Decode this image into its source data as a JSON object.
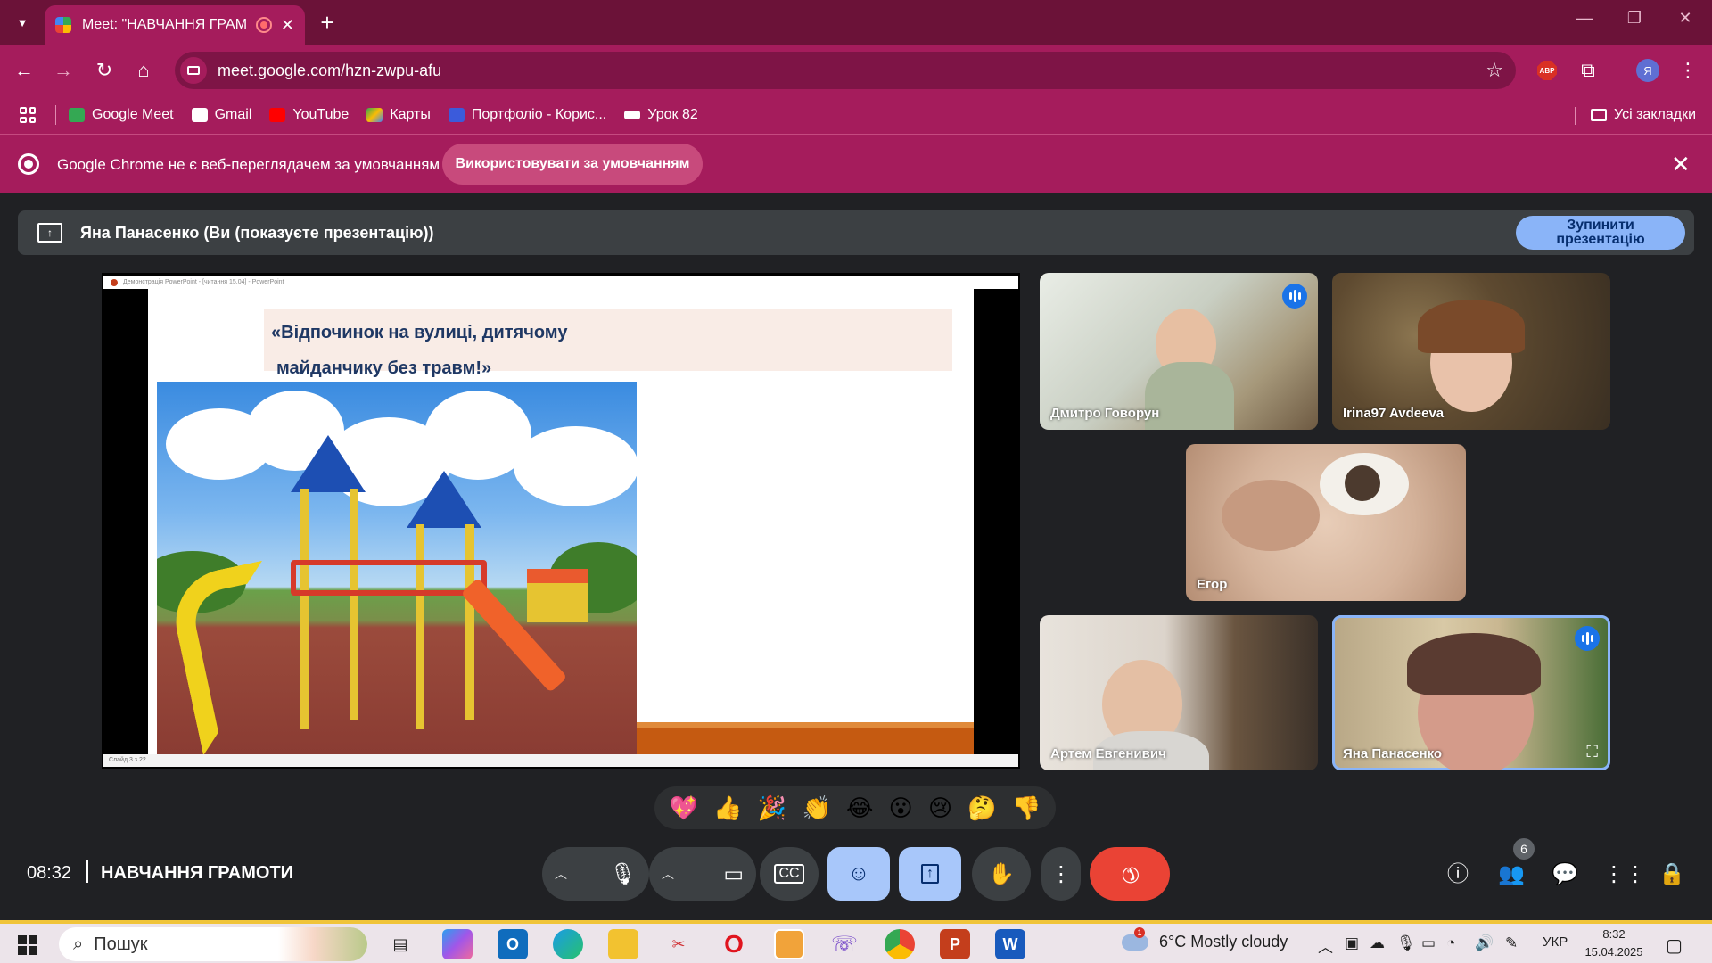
{
  "browser": {
    "tab_title": "Meet: \"НАВЧАННЯ ГРАМОТ",
    "url": "meet.google.com/hzn-zwpu-afu",
    "profile_initial": "Я",
    "bookmarks": [
      {
        "label": "Google Meet",
        "color": "#34a853"
      },
      {
        "label": "Gmail",
        "color": "#ffffff"
      },
      {
        "label": "YouTube",
        "color": "#ff0000"
      },
      {
        "label": "Карты",
        "color": "#4285f4"
      },
      {
        "label": "Портфоліо - Корис...",
        "color": "#3b5bdb"
      },
      {
        "label": "Урок 82",
        "color": "#ffffff"
      }
    ],
    "all_bookmarks": "Усі закладки",
    "infobar_text": "Google Chrome не є веб-переглядачем за умовчанням",
    "infobar_button": "Використовувати за умовчанням"
  },
  "meet": {
    "presenting_text": "Яна Панасенко (Ви (показуєте презентацію))",
    "stop_button_line1": "Зупинити",
    "stop_button_line2": "презентацію",
    "slide": {
      "window_title": "Демонстрація PowerPoint - [читання 15.04] - PowerPoint",
      "title_line1": "«Відпочинок на вулиці, дитячому",
      "title_line2": "майданчику без травм!»",
      "status": "Слайд 3 з 22"
    },
    "participants": [
      {
        "name": "Дмитро Говорун",
        "speaking": true
      },
      {
        "name": "Irina97 Avdeeva",
        "speaking": false
      },
      {
        "name": "Егор",
        "speaking": false
      },
      {
        "name": "Артем Евгенивич",
        "speaking": false
      },
      {
        "name": "Яна Панасенко",
        "speaking": true
      }
    ],
    "reactions": [
      "💖",
      "👍",
      "🎉",
      "👏",
      "😂",
      "😮",
      "😢",
      "🤔",
      "👎"
    ],
    "time": "08:32",
    "meeting_name": "НАВЧАННЯ ГРАМОТИ",
    "people_count": "6"
  },
  "taskbar": {
    "search_placeholder": "Пошук",
    "weather": "6°C  Mostly cloudy",
    "language": "УКР",
    "time": "8:32",
    "date": "15.04.2025"
  }
}
